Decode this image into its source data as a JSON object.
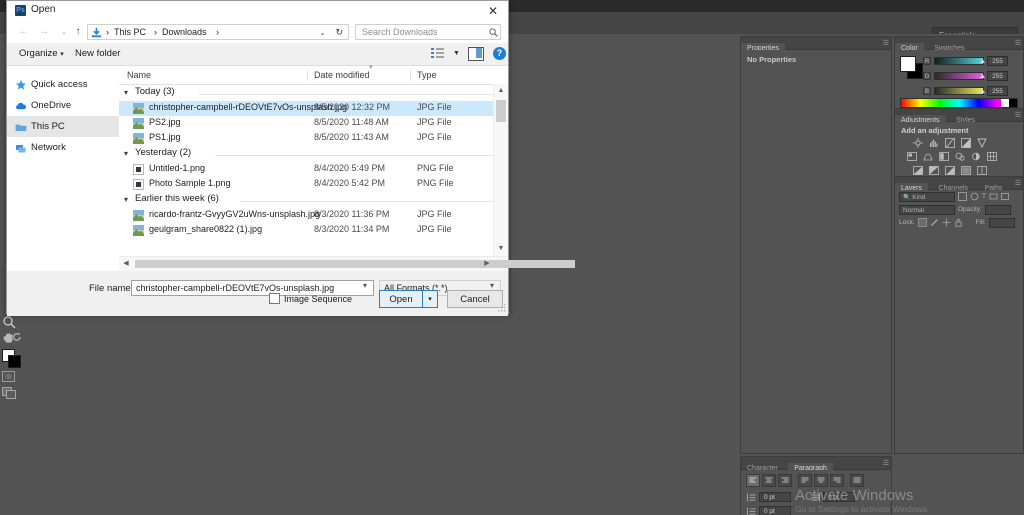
{
  "app": {
    "workspace_label": "Essentials",
    "watermark": {
      "line1": "Activate Windows",
      "line2": "Go to Settings to activate Windows."
    },
    "toolbar": {
      "tools": [
        "zoom-tool",
        "hand-tool",
        "rotate-view-tool",
        "color-swatches",
        "quick-mask-tool",
        "screen-mode-tool"
      ]
    }
  },
  "panels": {
    "properties": {
      "tabs": [
        "Properties"
      ],
      "active_tab": "Properties",
      "empty_text": "No Properties"
    },
    "color": {
      "tabs": [
        "Color",
        "Swatches"
      ],
      "active_tab": "Color",
      "channels": [
        {
          "label": "R",
          "value": "255"
        },
        {
          "label": "G",
          "value": "255"
        },
        {
          "label": "B",
          "value": "255"
        }
      ],
      "foreground_color": "#ffffff",
      "background_color": "#000000"
    },
    "adjustments": {
      "tabs": [
        "Adjustments",
        "Styles"
      ],
      "active_tab": "Adjustments",
      "title": "Add an adjustment",
      "row1": [
        "brightness-contrast-icon",
        "levels-icon",
        "curves-icon",
        "exposure-icon",
        "vibrance-icon"
      ],
      "row2": [
        "hue-saturation-icon",
        "color-balance-icon",
        "black-white-icon",
        "photo-filter-icon",
        "channel-mixer-icon",
        "color-lookup-icon"
      ],
      "row3": [
        "invert-icon",
        "posterize-icon",
        "threshold-icon",
        "gradient-map-icon",
        "selective-color-icon"
      ]
    },
    "layers": {
      "tabs": [
        "Layers",
        "Channels",
        "Paths"
      ],
      "active_tab": "Layers",
      "filter_label": "Kind",
      "blend_mode": "Normal",
      "opacity_label": "Opacity:",
      "lock_label": "Lock:",
      "fill_label": "Fill:"
    },
    "paragraph": {
      "tabs": [
        "Character",
        "Paragraph"
      ],
      "active_tab": "Paragraph",
      "indent_left": "0 pt",
      "indent_right": "0 pt",
      "indent_first": "0 pt"
    }
  },
  "dialog": {
    "title": "Open",
    "close_label": "✕",
    "nav": {
      "back": "←",
      "forward": "→",
      "recent": "⌄",
      "up": "↑"
    },
    "address": {
      "breadcrumbs": [
        "This PC",
        "Downloads"
      ],
      "separator": "›",
      "dropdown_caret": "⌄",
      "refresh": "↻"
    },
    "search": {
      "placeholder": "Search Downloads",
      "value": ""
    },
    "commands": {
      "organize": "Organize",
      "new_folder": "New folder",
      "caret": "▾",
      "view_icon": "view-options-icon",
      "preview_pane_icon": "preview-pane-icon",
      "help_label": "?"
    },
    "nav_pane": [
      {
        "label": "Quick access",
        "icon": "star-icon",
        "selected": false
      },
      {
        "label": "OneDrive",
        "icon": "cloud-icon",
        "selected": false
      },
      {
        "label": "This PC",
        "icon": "pc-icon",
        "selected": true
      },
      {
        "label": "Network",
        "icon": "network-icon",
        "selected": false
      }
    ],
    "columns": [
      "Name",
      "Date modified",
      "Type"
    ],
    "groups": [
      {
        "header": "Today (3)",
        "rows": [
          {
            "name": "christopher-campbell-rDEOVtE7vOs-unsplash.jpg",
            "date": "8/5/2020 12:32 PM",
            "type": "JPG File",
            "icon": "jpg-thumb-icon",
            "selected": true
          },
          {
            "name": "PS2.jpg",
            "date": "8/5/2020 11:48 AM",
            "type": "JPG File",
            "icon": "jpg-thumb-icon",
            "selected": false
          },
          {
            "name": "PS1.jpg",
            "date": "8/5/2020 11:43 AM",
            "type": "JPG File",
            "icon": "jpg-thumb-icon",
            "selected": false
          }
        ]
      },
      {
        "header": "Yesterday (2)",
        "rows": [
          {
            "name": "Untitled-1.png",
            "date": "8/4/2020 5:49 PM",
            "type": "PNG File",
            "icon": "png-icon",
            "selected": false
          },
          {
            "name": "Photo Sample 1.png",
            "date": "8/4/2020 5:42 PM",
            "type": "PNG File",
            "icon": "png-icon",
            "selected": false
          }
        ]
      },
      {
        "header": "Earlier this week (6)",
        "rows": [
          {
            "name": "ricardo-frantz-GvyyGV2uWns-unsplash.jpg",
            "date": "8/3/2020 11:36 PM",
            "type": "JPG File",
            "icon": "jpg-thumb-icon",
            "selected": false
          },
          {
            "name": "geulgram_share0822 (1).jpg",
            "date": "8/3/2020 11:34 PM",
            "type": "JPG File",
            "icon": "jpg-thumb-icon",
            "selected": false
          }
        ]
      }
    ],
    "footer": {
      "file_name_label": "File name:",
      "file_name_value": "christopher-campbell-rDEOVtE7vOs-unsplash.jpg",
      "file_name_placeholder": "File name",
      "format_value": "All Formats (*.*)",
      "image_sequence_label": "Image Sequence",
      "open_label": "Open",
      "open_split_caret": "▾",
      "cancel_label": "Cancel"
    }
  },
  "colors": {
    "accent_blue": "#1a7fd4",
    "selection_blue": "#cce8ff",
    "ps_panel": "#535353",
    "ps_chrome": "#454545"
  }
}
